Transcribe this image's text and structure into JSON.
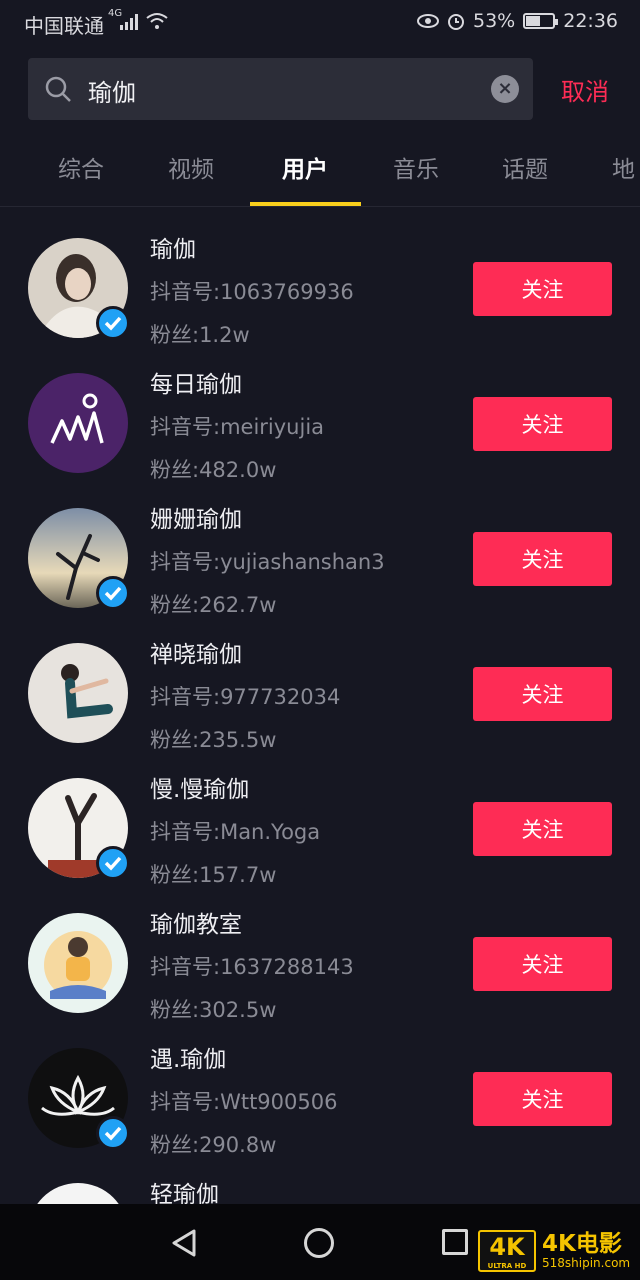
{
  "status_bar": {
    "carrier": "中国联通",
    "network": "4G",
    "battery_pct": "53%",
    "battery_level": 0.53,
    "time": "22:36"
  },
  "search": {
    "query": "瑜伽",
    "cancel_label": "取消"
  },
  "tabs": [
    {
      "label": "综合",
      "active": false
    },
    {
      "label": "视频",
      "active": false
    },
    {
      "label": "用户",
      "active": true
    },
    {
      "label": "音乐",
      "active": false
    },
    {
      "label": "话题",
      "active": false
    },
    {
      "label": "地",
      "active": false
    }
  ],
  "users": [
    {
      "name": "瑜伽",
      "id": "抖音号:1063769936",
      "fans": "粉丝:1.2w",
      "verified": true,
      "follow_label": "关注"
    },
    {
      "name": "每日瑜伽",
      "id": "抖音号:meiriyujia",
      "fans": "粉丝:482.0w",
      "verified": false,
      "follow_label": "关注"
    },
    {
      "name": "姗姗瑜伽",
      "id": "抖音号:yujiashanshan3",
      "fans": "粉丝:262.7w",
      "verified": true,
      "follow_label": "关注"
    },
    {
      "name": "禅晓瑜伽",
      "id": "抖音号:977732034",
      "fans": "粉丝:235.5w",
      "verified": false,
      "follow_label": "关注"
    },
    {
      "name": "慢.慢瑜伽",
      "id": "抖音号:Man.Yoga",
      "fans": "粉丝:157.7w",
      "verified": true,
      "follow_label": "关注"
    },
    {
      "name": "瑜伽教室",
      "id": "抖音号:1637288143",
      "fans": "粉丝:302.5w",
      "verified": false,
      "follow_label": "关注"
    },
    {
      "name": "遇.瑜伽",
      "id": "抖音号:Wtt900506",
      "fans": "粉丝:290.8w",
      "verified": true,
      "follow_label": "关注"
    },
    {
      "name": "轻瑜伽",
      "id": "",
      "fans": "",
      "verified": false,
      "follow_label": ""
    }
  ],
  "watermark": {
    "badge": "4K",
    "badge_sub": "ULTRA HD",
    "text": "4K电影",
    "url": "518shipin.com"
  },
  "colors": {
    "background": "#161722",
    "accent_red": "#fe2c55",
    "tab_indicator": "#f9cf1c",
    "verified_blue": "#20a1f5"
  }
}
